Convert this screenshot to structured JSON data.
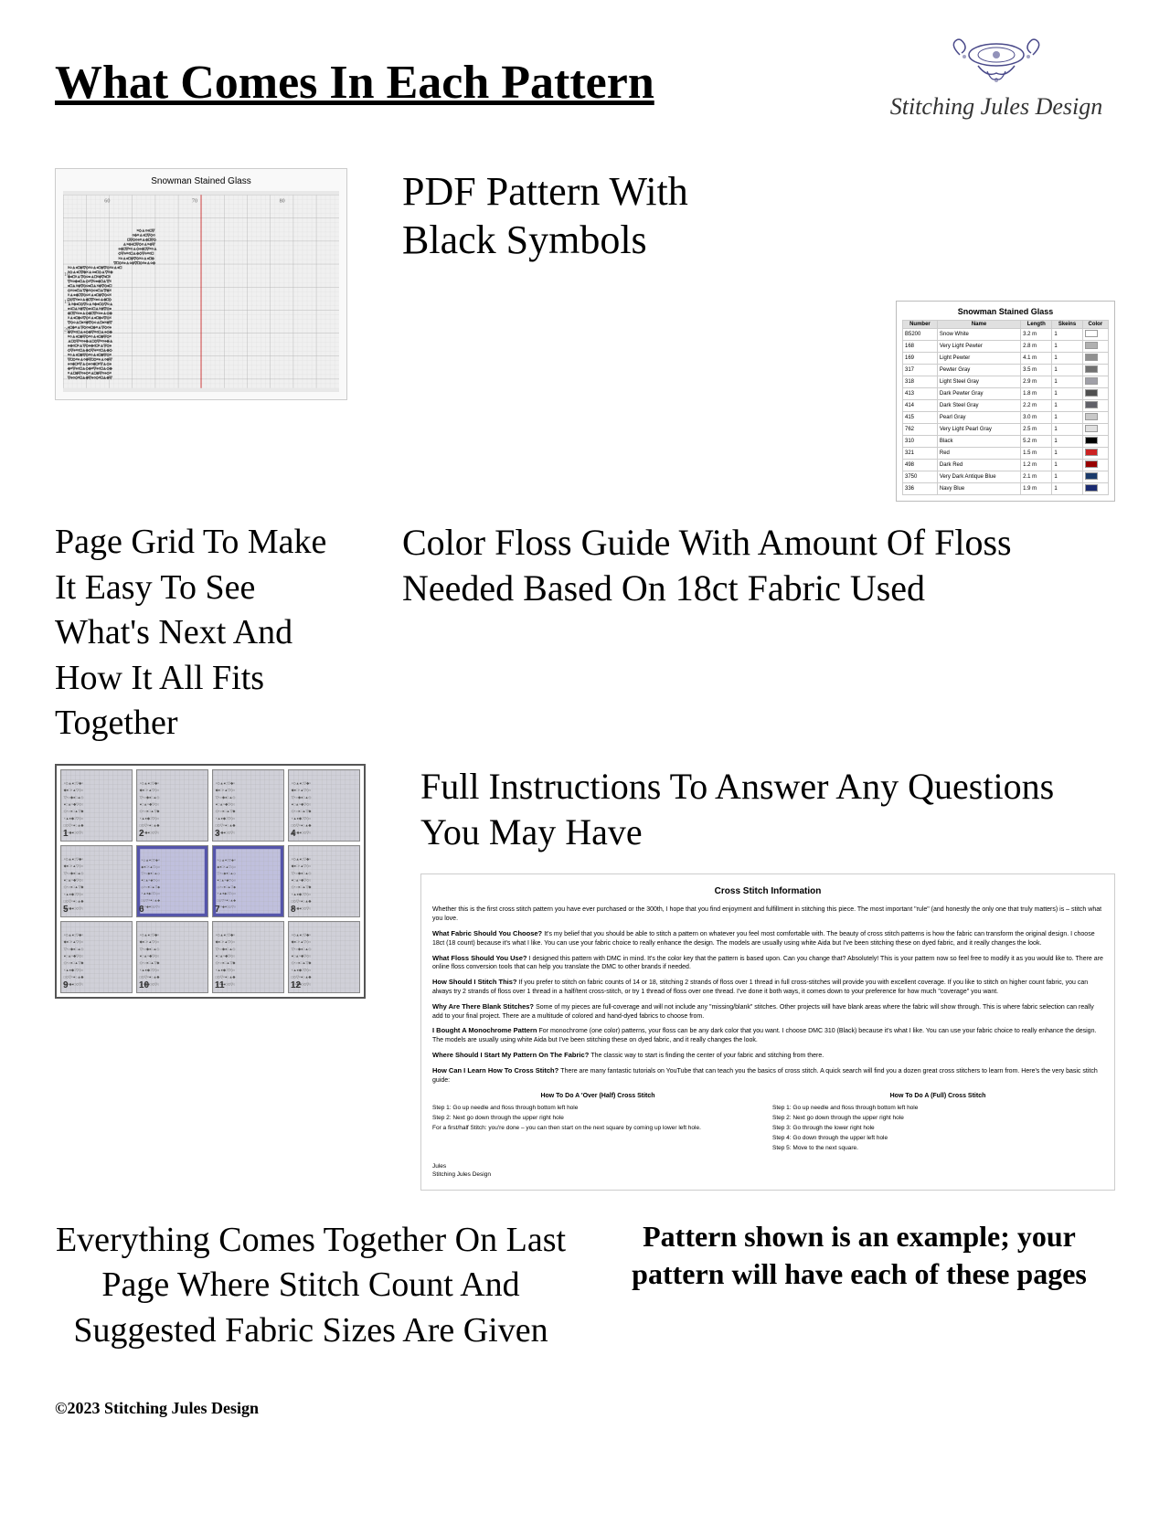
{
  "header": {
    "main_title": "What Comes In Each Pattern",
    "brand_name": "Stitching Jules Design",
    "brand_ornament": "❧❦"
  },
  "sections": {
    "pdf_pattern": {
      "preview_title": "Snowman Stained Glass",
      "heading_line1": "PDF Pattern With",
      "heading_line2": "Black Symbols",
      "floss_table_title": "Snowman Stained Glass",
      "floss_columns": [
        "Number",
        "Name",
        "Length",
        "Skeins"
      ],
      "floss_rows": [
        {
          "number": "B5200",
          "name": "Snow White",
          "length": "3.2 m",
          "skein": "1",
          "color": "#ffffff"
        },
        {
          "number": "168",
          "name": "Very Light Pewter",
          "length": "2.8 m",
          "skein": "1",
          "color": "#b0b0b0"
        },
        {
          "number": "169",
          "name": "Light Pewter",
          "length": "4.1 m",
          "skein": "1",
          "color": "#909090"
        },
        {
          "number": "317",
          "name": "Pewter Gray",
          "length": "3.5 m",
          "skein": "1",
          "color": "#707070"
        },
        {
          "number": "318",
          "name": "Light Steel Gray",
          "length": "2.9 m",
          "skein": "1",
          "color": "#a0a0a8"
        },
        {
          "number": "413",
          "name": "Dark Pewter Gray",
          "length": "1.8 m",
          "skein": "1",
          "color": "#505050"
        },
        {
          "number": "414",
          "name": "Dark Steel Gray",
          "length": "2.2 m",
          "skein": "1",
          "color": "#606068"
        },
        {
          "number": "415",
          "name": "Pearl Gray",
          "length": "3.0 m",
          "skein": "1",
          "color": "#c8c8c8"
        },
        {
          "number": "762",
          "name": "Very Light Pearl Gray",
          "length": "2.5 m",
          "skein": "1",
          "color": "#e0e0e0"
        },
        {
          "number": "310",
          "name": "Black",
          "length": "5.2 m",
          "skein": "1",
          "color": "#000000"
        },
        {
          "number": "321",
          "name": "Red",
          "length": "1.5 m",
          "skein": "1",
          "color": "#cc2222"
        },
        {
          "number": "498",
          "name": "Dark Red",
          "length": "1.2 m",
          "skein": "1",
          "color": "#990000"
        },
        {
          "number": "3750",
          "name": "Very Dark Antique Blue",
          "length": "2.1 m",
          "skein": "1",
          "color": "#1a3a6a"
        },
        {
          "number": "336",
          "name": "Navy Blue",
          "length": "1.9 m",
          "skein": "1",
          "color": "#1a2a70"
        }
      ]
    },
    "floss_guide": {
      "heading": "Color Floss Guide With Amount Of Floss Needed Based On 18ct Fabric Used"
    },
    "page_grid": {
      "text": "Page Grid To Make It Easy To See What's Next And How It All Fits Together",
      "thumbnails": [
        {
          "number": "1",
          "highlighted": false
        },
        {
          "number": "2",
          "highlighted": false
        },
        {
          "number": "3",
          "highlighted": false
        },
        {
          "number": "4",
          "highlighted": false
        },
        {
          "number": "5",
          "highlighted": false
        },
        {
          "number": "6",
          "highlighted": true
        },
        {
          "number": "7",
          "highlighted": true
        },
        {
          "number": "8",
          "highlighted": false
        },
        {
          "number": "9",
          "highlighted": false
        },
        {
          "number": "10",
          "highlighted": false
        },
        {
          "number": "11",
          "highlighted": false
        },
        {
          "number": "12",
          "highlighted": false
        }
      ]
    },
    "instructions": {
      "heading": "Full Instructions To Answer Any Questions You May Have",
      "doc_title": "Cross Stitch Information",
      "doc_intro": "Whether this is the first cross stitch pattern you have ever purchased or the 300th, I hope that you find enjoyment and fulfillment in stitching this piece. The most important \"rule\" (and honestly the only one that truly matters) is – stitch what you love.",
      "doc_sections": [
        {
          "title": "What Fabric Should You Choose?",
          "text": "It's my belief that you should be able to stitch a pattern on whatever you feel most comfortable with. The beauty of cross stitch patterns is how the fabric can transform the original design. I choose 18ct (18 count) because it's what I like. You can use your fabric choice to really enhance the design. The models are usually using white Aida but I've been stitching these on dyed fabric, and it really changes the look."
        },
        {
          "title": "What Floss Should You Use?",
          "text": "I designed this pattern with DMC in mind. It's the color key that the pattern is based upon. Can you change that? Absolutely! This is your pattern now so feel free to modify it as you would like to. There are online floss conversion tools that can help you translate the DMC to other brands if needed."
        },
        {
          "title": "How Should I Stitch This?",
          "text": "If you prefer to stitch on fabric counts of 14 or 18, stitching 2 strands of floss over 1 thread in full cross-stitches will provide you with excellent coverage. If you like to stitch on higher count fabric, you can always try 2 strands of floss over 1 thread in a half/tent cross-stitch, or try 1 thread of floss over one thread. I've done it both ways, it comes down to your preference for how much \"coverage\" you want."
        },
        {
          "title": "Why Are There Blank Stitches?",
          "text": "Some of my pieces are full-coverage and will not include any \"missing/blank\" stitches. Other projects will have blank areas where the fabric will show through. This is where fabric selection can really add to your final project. There are a multitude of colored and hand-dyed fabrics to choose from."
        },
        {
          "title": "I Bought A Monochrome Pattern",
          "text": "For monochrome (one color) patterns, your floss can be any dark color that you want. I choose DMC 310 (Black) because it's what I like. You can use your fabric choice to really enhance the design. The models are usually using white Aida but I've been stitching these on dyed fabric, and it really changes the look."
        },
        {
          "title": "Where Should I Start My Pattern On The Fabric?",
          "text": "The classic way to start is finding the center of your fabric and stitching from there."
        },
        {
          "title": "How Can I Learn How To Cross Stitch?",
          "text": "There are many fantastic tutorials on YouTube that can teach you the basics of cross stitch. A quick search will find you a dozen great cross stitchers to learn from. Here's the very basic stitch guide:"
        }
      ],
      "stitch_columns": [
        {
          "title": "How To Do A 'Over (Half) Cross Stitch",
          "steps": [
            "Step 1: Go up needle and floss through bottom left hole",
            "Step 2: Next go down through the upper right hole",
            "For a first/half Stitch: you're done – you can then start on the next square by coming up lower left hole."
          ]
        },
        {
          "title": "How To Do A (Full) Cross Stitch",
          "steps": [
            "Step 1: Go up needle and floss through bottom left hole",
            "Step 2: Next go down through the upper right hole",
            "Step 3: Go through the lower right hole",
            "Step 4: Go down through the upper left hole",
            "Step 5: Move to the next square."
          ]
        }
      ],
      "signature": "Jules\nStitching Jules Design"
    },
    "bottom": {
      "last_page_text": "Everything Comes Together On Last Page Where Stitch Count And Suggested Fabric Sizes Are Given",
      "pattern_note": "Pattern shown is an example; your pattern will have each of these pages"
    }
  },
  "footer": {
    "copyright": "©2023 Stitching Jules Design"
  }
}
